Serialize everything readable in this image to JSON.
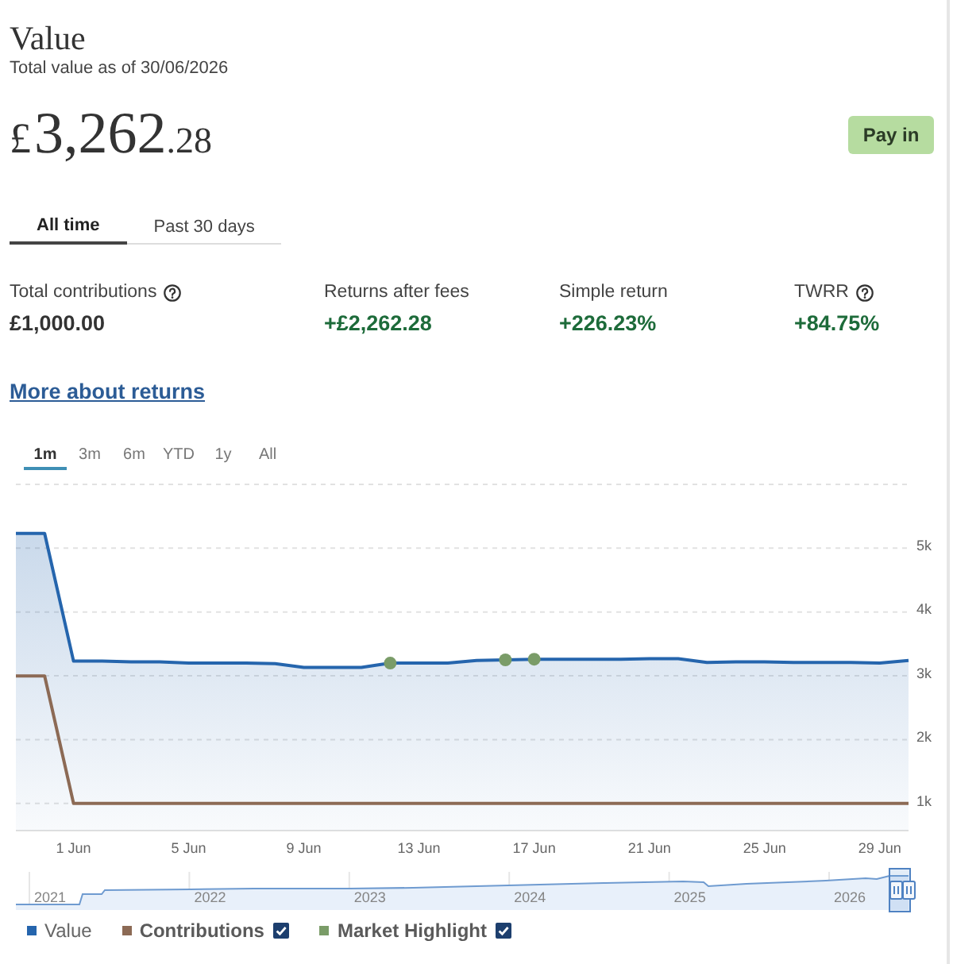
{
  "header": {
    "title": "Value",
    "caption": "Total value as of 30/06/2026",
    "amount": {
      "currency": "£",
      "units": "3,262",
      "pence": ".28"
    },
    "pay_in_button": "Pay in"
  },
  "period_tabs": [
    {
      "label": "All time",
      "selected": true
    },
    {
      "label": "Past 30 days",
      "selected": false
    }
  ],
  "stats": [
    {
      "label": "Total contributions",
      "info": true,
      "value": "£1,000.00",
      "kind": "neutral"
    },
    {
      "label": "Returns after fees",
      "info": false,
      "value": "+£2,262.28",
      "kind": "gain"
    },
    {
      "label": "Simple return",
      "info": false,
      "value": "+226.23%",
      "kind": "gain"
    },
    {
      "label": "TWRR",
      "info": true,
      "value": "+84.75%",
      "kind": "gain"
    }
  ],
  "returns_link": "More about returns",
  "range_tabs": [
    {
      "label": "1m",
      "selected": true
    },
    {
      "label": "3m",
      "selected": false
    },
    {
      "label": "6m",
      "selected": false
    },
    {
      "label": "YTD",
      "selected": false
    },
    {
      "label": "1y",
      "selected": false
    },
    {
      "label": "All",
      "selected": false
    }
  ],
  "chart": {
    "chart_data": {
      "type": "line",
      "categories": [
        null,
        null,
        "1 Jun",
        null,
        null,
        null,
        "5 Jun",
        null,
        null,
        null,
        "9 Jun",
        null,
        null,
        null,
        "13 Jun",
        null,
        null,
        null,
        "17 Jun",
        null,
        null,
        null,
        "21 Jun",
        null,
        null,
        null,
        "25 Jun",
        null,
        null,
        null,
        "29 Jun",
        null
      ],
      "series": [
        {
          "name": "Value",
          "type": "area",
          "color": "#2565ad",
          "values": [
            5230,
            5230,
            3230,
            3230,
            3220,
            3220,
            3200,
            3200,
            3200,
            3190,
            3130,
            3130,
            3130,
            3200,
            3200,
            3200,
            3240,
            3250,
            3260,
            3260,
            3260,
            3260,
            3270,
            3270,
            3210,
            3220,
            3220,
            3210,
            3210,
            3210,
            3200,
            3240
          ]
        },
        {
          "name": "Contributions",
          "type": "line",
          "color": "#8c6a55",
          "values": [
            3000,
            3000,
            1000,
            1000,
            1000,
            1000,
            1000,
            1000,
            1000,
            1000,
            1000,
            1000,
            1000,
            1000,
            1000,
            1000,
            1000,
            1000,
            1000,
            1000,
            1000,
            1000,
            1000,
            1000,
            1000,
            1000,
            1000,
            1000,
            1000,
            1000,
            1000,
            1000
          ]
        },
        {
          "name": "Market Highlight",
          "type": "scatter",
          "color": "#7a9c68",
          "values": [
            null,
            null,
            null,
            null,
            null,
            null,
            null,
            null,
            null,
            null,
            null,
            null,
            null,
            3200,
            null,
            null,
            null,
            3250,
            3260,
            null,
            null,
            null,
            null,
            null,
            null,
            null,
            null,
            null,
            null,
            null,
            null,
            null
          ]
        }
      ],
      "ylim": [
        575,
        6000
      ],
      "yticks": [
        {
          "value": 1000,
          "label": "1k"
        },
        {
          "value": 2000,
          "label": "2k"
        },
        {
          "value": 3000,
          "label": "3k"
        },
        {
          "value": 4000,
          "label": "4k"
        },
        {
          "value": 5000,
          "label": "5k"
        }
      ],
      "grid": true
    },
    "navigator": {
      "years": [
        "2021",
        "2022",
        "2023",
        "2024",
        "2025",
        "2026"
      ]
    },
    "legend": [
      {
        "has_checkbox": false
      },
      {
        "has_checkbox": true,
        "checked": true
      },
      {
        "has_checkbox": true,
        "checked": true
      }
    ]
  }
}
